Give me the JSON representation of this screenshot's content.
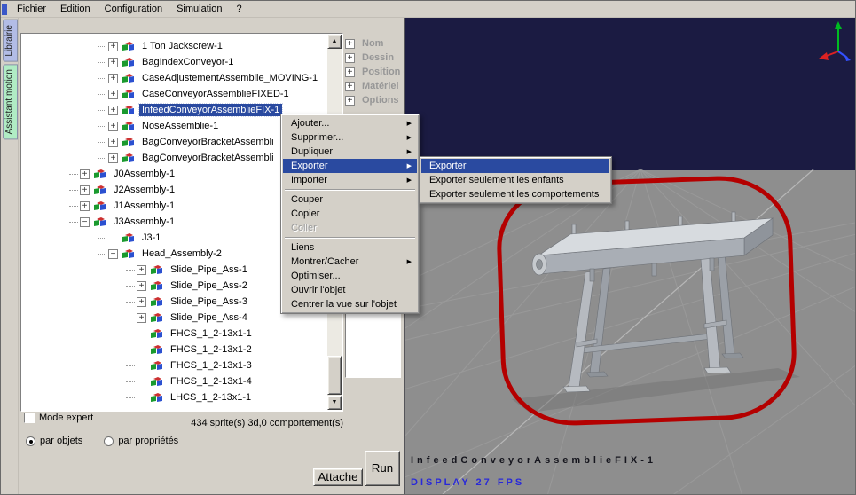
{
  "colors": {
    "selection": "#2a4aa0",
    "window_bg": "#d4d0c8",
    "sky": "#1b1b42",
    "floor": "#8e8e8e",
    "annotation": "#b40000"
  },
  "menubar": {
    "items": [
      "Fichier",
      "Edition",
      "Configuration",
      "Simulation",
      "?"
    ]
  },
  "side_tabs": {
    "items": [
      {
        "label": "Librairie",
        "color": "#b2bce6"
      },
      {
        "label": "Assistant motion",
        "color": "#b0ecc4"
      }
    ]
  },
  "tree": {
    "items": [
      {
        "label": "1 Ton Jackscrew-1",
        "depth": 2,
        "toggle": "plus"
      },
      {
        "label": "BagIndexConveyor-1",
        "depth": 2,
        "toggle": "plus"
      },
      {
        "label": "CaseAdjustementAssemblie_MOVING-1",
        "depth": 2,
        "toggle": "plus"
      },
      {
        "label": "CaseConveyorAssemblieFIXED-1",
        "depth": 2,
        "toggle": "plus"
      },
      {
        "label": "InfeedConveyorAssemblieFIX-1",
        "depth": 2,
        "toggle": "plus",
        "selected": true
      },
      {
        "label": "NoseAssemblie-1",
        "depth": 2,
        "toggle": "plus"
      },
      {
        "label": "BagConveyorBracketAssembli",
        "depth": 2,
        "toggle": "plus"
      },
      {
        "label": "BagConveyorBracketAssembli",
        "depth": 2,
        "toggle": "plus"
      },
      {
        "label": "J0Assembly-1",
        "depth": 1,
        "toggle": "plus"
      },
      {
        "label": "J2Assembly-1",
        "depth": 1,
        "toggle": "plus"
      },
      {
        "label": "J1Assembly-1",
        "depth": 1,
        "toggle": "plus"
      },
      {
        "label": "J3Assembly-1",
        "depth": 1,
        "toggle": "minus"
      },
      {
        "label": "J3-1",
        "depth": 2,
        "toggle": "none"
      },
      {
        "label": "Head_Assembly-2",
        "depth": 2,
        "toggle": "minus"
      },
      {
        "label": "Slide_Pipe_Ass-1",
        "depth": 3,
        "toggle": "plus"
      },
      {
        "label": "Slide_Pipe_Ass-2",
        "depth": 3,
        "toggle": "plus"
      },
      {
        "label": "Slide_Pipe_Ass-3",
        "depth": 3,
        "toggle": "plus"
      },
      {
        "label": "Slide_Pipe_Ass-4",
        "depth": 3,
        "toggle": "plus"
      },
      {
        "label": "FHCS_1_2-13x1-1",
        "depth": 3,
        "toggle": "none"
      },
      {
        "label": "FHCS_1_2-13x1-2",
        "depth": 3,
        "toggle": "none"
      },
      {
        "label": "FHCS_1_2-13x1-3",
        "depth": 3,
        "toggle": "none"
      },
      {
        "label": "FHCS_1_2-13x1-4",
        "depth": 3,
        "toggle": "none"
      },
      {
        "label": "LHCS_1_2-13x1-1",
        "depth": 3,
        "toggle": "none"
      }
    ]
  },
  "properties": {
    "items": [
      "Nom",
      "Dessin",
      "Position e",
      "Matériel",
      "Options"
    ]
  },
  "footer": {
    "mode_expert_label": "Mode expert",
    "stats": "434 sprite(s) 3d,0 comportement(s)",
    "radio_objects": "par objets",
    "radio_properties": "par propriétés",
    "attache_button": "Attache",
    "run_button": "Run"
  },
  "context_menu": {
    "items": [
      {
        "label": "Ajouter...",
        "submenu": true
      },
      {
        "label": "Supprimer...",
        "submenu": true
      },
      {
        "label": "Dupliquer",
        "submenu": true
      },
      {
        "label": "Exporter",
        "submenu": true,
        "highlighted": true
      },
      {
        "label": "Importer",
        "submenu": true
      },
      {
        "type": "separator"
      },
      {
        "label": "Couper"
      },
      {
        "label": "Copier"
      },
      {
        "label": "Coller",
        "disabled": true
      },
      {
        "type": "separator"
      },
      {
        "label": "Liens"
      },
      {
        "label": "Montrer/Cacher",
        "submenu": true
      },
      {
        "label": "Optimiser..."
      },
      {
        "label": "Ouvrir l'objet"
      },
      {
        "label": "Centrer la vue sur l'objet"
      }
    ]
  },
  "export_submenu": {
    "items": [
      {
        "label": "Exporter",
        "highlighted": true
      },
      {
        "label": "Exporter seulement les enfants"
      },
      {
        "label": "Exporter seulement les comportements"
      }
    ]
  },
  "viewport": {
    "object_label": "InfeedConveyorAssemblieFIX-1",
    "fps_label": "DISPLAY 27 FPS"
  }
}
